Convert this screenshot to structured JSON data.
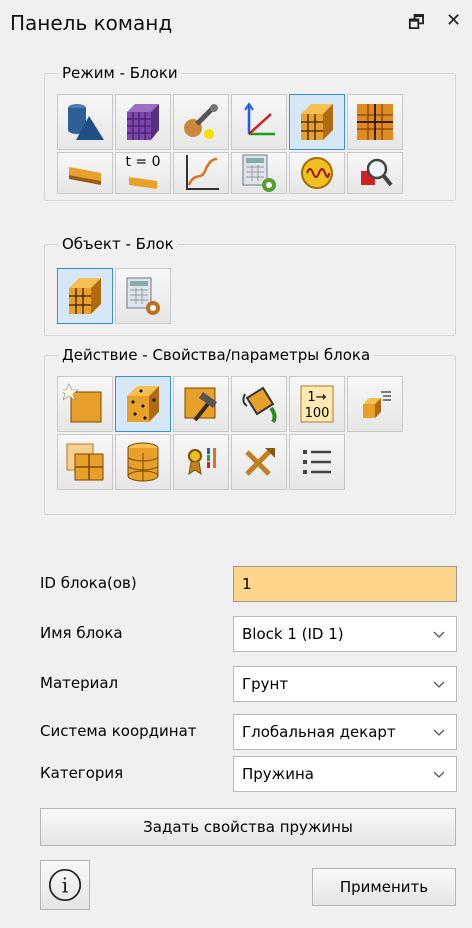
{
  "title": "Панель команд",
  "window_buttons": {
    "float": "🗗",
    "close": "✕"
  },
  "groups": {
    "mode": {
      "label": "Режим - Блоки"
    },
    "object": {
      "label": "Объект - Блок"
    },
    "action": {
      "label": "Действие - Свойства/параметры блока"
    }
  },
  "icons": {
    "tzero": "t = 0",
    "range_top": "1→",
    "range_bottom": "100"
  },
  "form": {
    "block_ids": {
      "label": "ID блока(ов)",
      "value": "1"
    },
    "block_name": {
      "label": "Имя блока",
      "value": "Block 1 (ID 1)"
    },
    "material": {
      "label": "Материал",
      "value": "Грунт"
    },
    "coord_system": {
      "label": "Система координат",
      "value": "Глобальная декарт"
    },
    "category": {
      "label": "Категория",
      "value": "Пружина"
    }
  },
  "buttons": {
    "spring_props": "Задать свойства пружины",
    "info": "i",
    "apply": "Применить"
  },
  "colors": {
    "accent": "#3c8ed8",
    "input_bg": "#ffd58c",
    "block_orange": "#e8a02a"
  }
}
